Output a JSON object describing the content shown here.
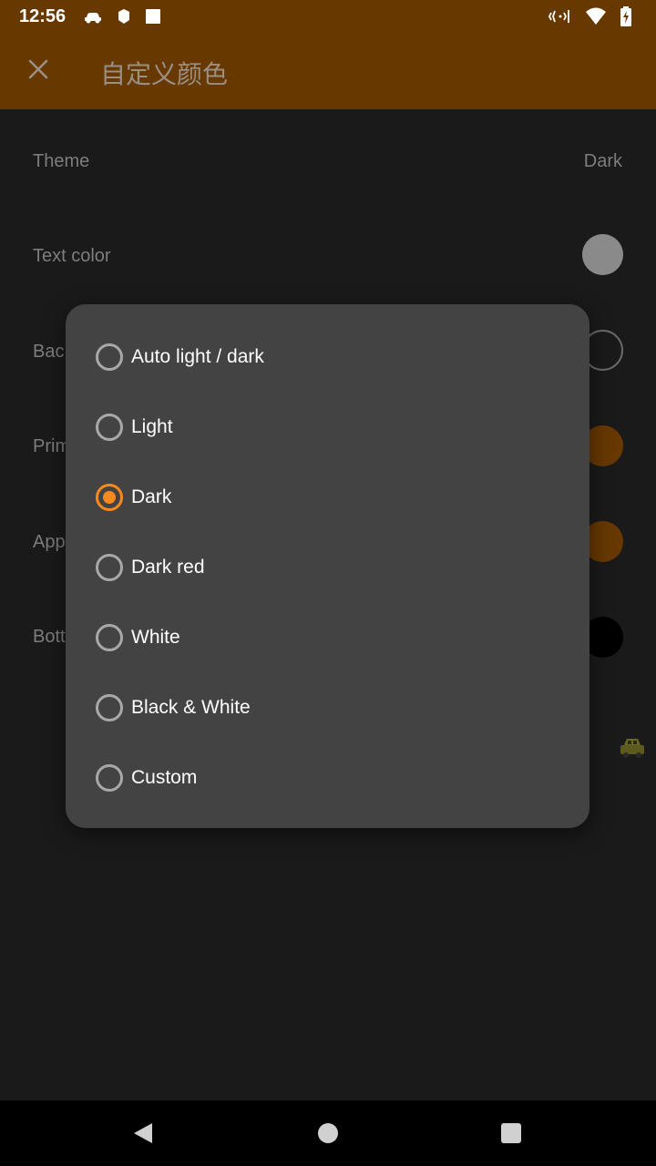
{
  "status_bar": {
    "time": "12:56"
  },
  "app_bar": {
    "title": "自定义颜色"
  },
  "settings": [
    {
      "label": "Theme",
      "value": "Dark"
    },
    {
      "label": "Text color",
      "swatch": "#8a8a8a"
    },
    {
      "label": "Bac",
      "swatch": "#1a1a1a"
    },
    {
      "label": "Prim",
      "swatch": "#673800"
    },
    {
      "label": "App",
      "swatch": "#673800"
    },
    {
      "label": "Bott",
      "swatch": "#000000"
    }
  ],
  "dialog": {
    "options": [
      {
        "label": "Auto light / dark",
        "checked": false
      },
      {
        "label": "Light",
        "checked": false
      },
      {
        "label": "Dark",
        "checked": true
      },
      {
        "label": "Dark red",
        "checked": false
      },
      {
        "label": "White",
        "checked": false
      },
      {
        "label": "Black & White",
        "checked": false
      },
      {
        "label": "Custom",
        "checked": false
      }
    ]
  },
  "colors": {
    "app_bar": "#673800",
    "background": "#1a1a1a",
    "dialog": "#434343",
    "accent": "#f7891e"
  },
  "icons": {
    "close": "close-icon",
    "cloud_car": "car-icon",
    "hexagon": "shield-icon",
    "square": "square-icon",
    "vibrate": "vibrate-icon",
    "wifi": "wifi-icon",
    "battery": "battery-charging-icon",
    "back": "back-icon",
    "home": "home-icon",
    "recents": "recents-icon"
  }
}
